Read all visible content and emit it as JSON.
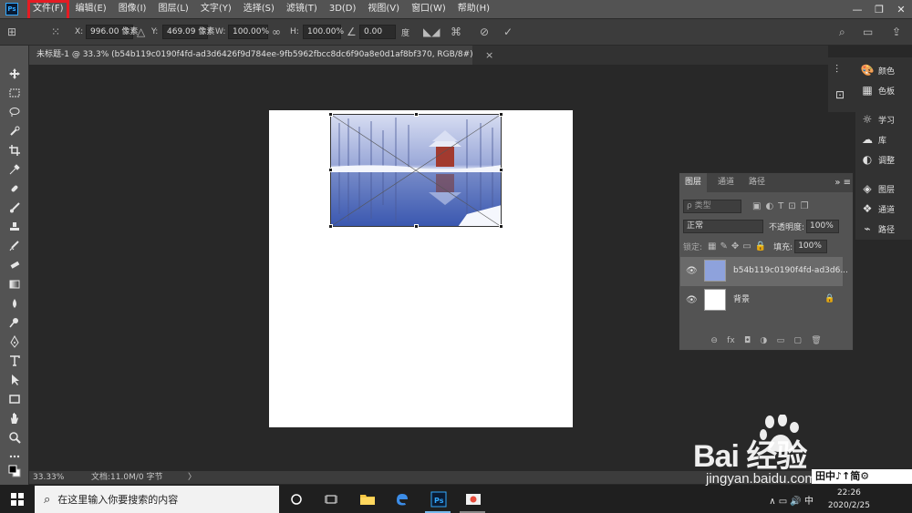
{
  "app": {
    "logo": "Ps",
    "menu": [
      "文件(F)",
      "编辑(E)",
      "图像(I)",
      "图层(L)",
      "文字(Y)",
      "选择(S)",
      "滤镜(T)",
      "3D(D)",
      "视图(V)",
      "窗口(W)",
      "帮助(H)"
    ],
    "window_controls": [
      "—",
      "❐",
      "✕"
    ],
    "highlight_color": "#e51c23"
  },
  "options": {
    "x_label": "X:",
    "x_value": "996.00 像素",
    "y_label": "Y:",
    "y_value": "469.09 像素",
    "w_label": "W:",
    "w_value": "100.00%",
    "h_label": "H:",
    "h_value": "100.00%",
    "angle_value": "0.00",
    "angle_unit": "度"
  },
  "document": {
    "tab_title": "未标题-1 @ 33.3% (b54b119c0190f4fd-ad3d6426f9d784ee-9fb5962fbcc8dc6f90a8e0d1af8bf370, RGB/8#)",
    "tab_close": "×",
    "zoom": "33.33%",
    "doc_info": "文档:11.0M/0 字节",
    "status_arrow": "〉"
  },
  "dock": {
    "items": [
      "颜色",
      "色板",
      "学习",
      "库",
      "调整",
      "图层",
      "通道",
      "路径"
    ]
  },
  "layers_panel": {
    "tabs": [
      "图层",
      "通道",
      "路径"
    ],
    "controls": "»  ≡",
    "filter_placeholder": "ρ 类型",
    "blend_mode": "正常",
    "opacity_label": "不透明度:",
    "opacity_value": "100%",
    "lock_label": "锁定:",
    "fill_label": "填充:",
    "fill_value": "100%",
    "layers": [
      {
        "name": "b54b119c0190f4fd-ad3d6...",
        "selected": true
      },
      {
        "name": "背景",
        "selected": false
      }
    ],
    "footer_icons": [
      "⊖",
      "fx",
      "◘",
      "◑",
      "▭",
      "▢",
      "🗑"
    ]
  },
  "taskbar": {
    "search_placeholder": "在这里输入你要搜索的内容",
    "clock_time": "22:26",
    "clock_date": "2020/2/25",
    "tray_text": "∧  ▭  🔊  中"
  },
  "watermark": {
    "brand": "Bai 经验",
    "url": "jingyan.baidu.com",
    "ime": "田中♪↑简⚙"
  }
}
